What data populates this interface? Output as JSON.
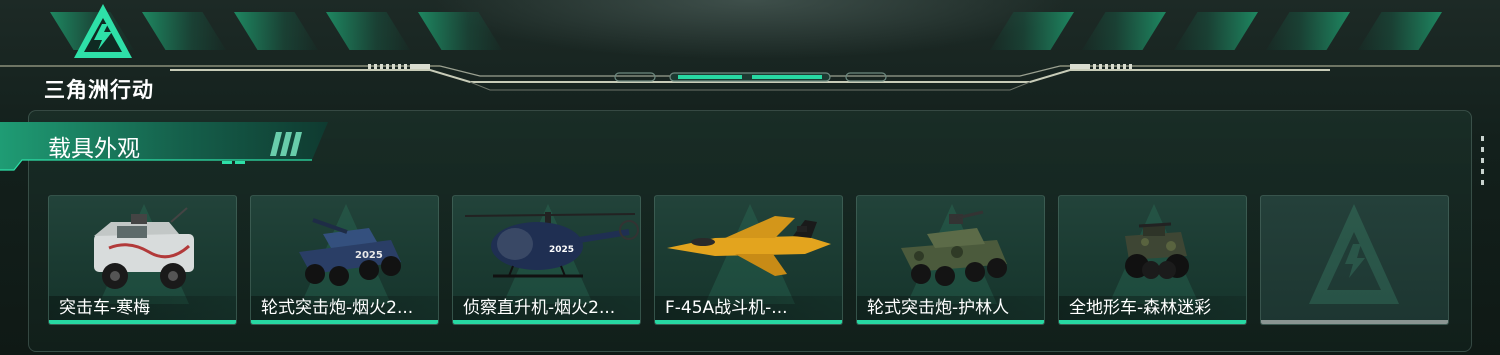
{
  "app": {
    "logo_text": "三角洲行动",
    "logo_icon": "delta-triangle-icon"
  },
  "section": {
    "title": "载具外观"
  },
  "colors": {
    "accent": "#27d8a2",
    "panel_bg": "#15261f",
    "empty_bar": "#8a9592"
  },
  "vehicles": [
    {
      "label": "突击车-寒梅",
      "icon": "assault-vehicle-icon"
    },
    {
      "label": "轮式突击炮-烟火2...",
      "icon": "wheeled-assault-gun-icon"
    },
    {
      "label": "侦察直升机-烟火2...",
      "icon": "scout-helicopter-icon"
    },
    {
      "label": "F-45A战斗机-...",
      "icon": "fighter-jet-icon"
    },
    {
      "label": "轮式突击炮-护林人",
      "icon": "wheeled-assault-gun-icon"
    },
    {
      "label": "全地形车-森林迷彩",
      "icon": "atv-icon"
    },
    {
      "label": "",
      "icon": "empty-slot-icon"
    }
  ]
}
